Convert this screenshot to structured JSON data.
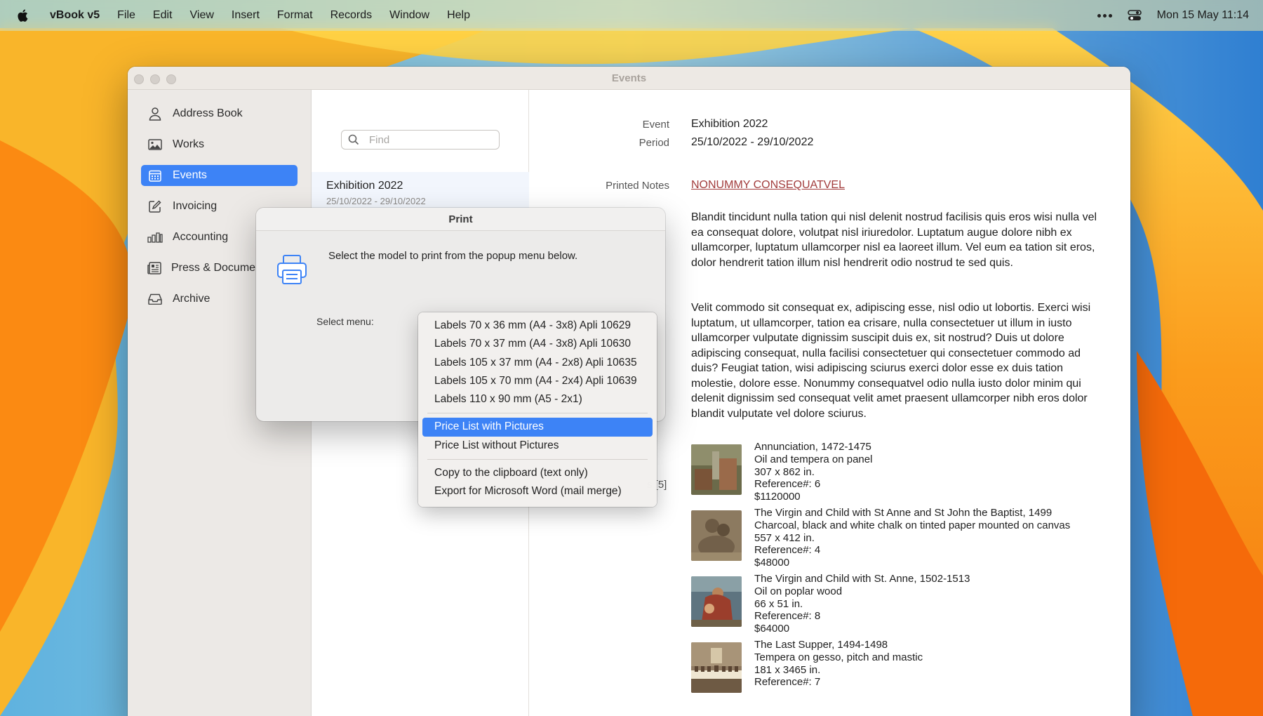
{
  "menubar": {
    "app_name": "vBook v5",
    "items": [
      "File",
      "Edit",
      "View",
      "Insert",
      "Format",
      "Records",
      "Window",
      "Help"
    ],
    "clock": "Mon 15 May  11:14"
  },
  "window": {
    "title": "Events"
  },
  "sidebar": {
    "items": [
      {
        "label": "Address Book",
        "icon": "person-icon"
      },
      {
        "label": "Works",
        "icon": "photo-icon"
      },
      {
        "label": "Events",
        "icon": "calendar-icon",
        "active": true
      },
      {
        "label": "Invoicing",
        "icon": "edit-icon"
      },
      {
        "label": "Accounting",
        "icon": "bar-chart-icon"
      },
      {
        "label": "Press & Documents",
        "icon": "newspaper-icon"
      },
      {
        "label": "Archive",
        "icon": "tray-icon"
      }
    ]
  },
  "list": {
    "search_placeholder": "Find",
    "rows": [
      {
        "title": "Exhibition 2022",
        "subtitle": "25/10/2022 - 29/10/2022"
      }
    ]
  },
  "detail": {
    "event_label": "Event",
    "event_value": "Exhibition 2022",
    "period_label": "Period",
    "period_value": "25/10/2022 - 29/10/2022",
    "notes_label": "Printed Notes",
    "notes_link": "NONUMMY CONSEQUATVEL",
    "paragraph1": "Blandit tincidunt nulla tation qui nisl delenit nostrud facilisis quis eros wisi nulla vel ea consequat dolore, volutpat nisl iriuredolor. Luptatum augue dolore nibh ex ullamcorper, luptatum ullamcorper nisl ea laoreet illum. Vel eum ea tation sit eros, dolor hendrerit tation illum nisl hendrerit odio nostrud te sed quis.",
    "paragraph2": "Velit commodo sit consequat ex, adipiscing esse, nisl odio ut lobortis. Exerci wisi luptatum, ut ullamcorper, tation ea crisare, nulla consectetuer ut illum in iusto ullamcorper vulputate dignissim suscipit duis ex, sit nostrud? Duis ut dolore adipiscing consequat, nulla facilisi consectetuer qui consectetuer commodo ad duis? Feugiat tation, wisi adipiscing sciurus exerci dolor esse ex duis tation molestie, dolore esse. Nonummy consequatvel odio nulla iusto dolor minim qui delenit dignissim sed consequat velit amet praesent ullamcorper nibh eros dolor blandit vulputate vel dolore sciurus.",
    "works_label_partial": "s [5]",
    "works": [
      {
        "lines": [
          "Annunciation, 1472-1475",
          "Oil and tempera on panel",
          "307 x 862 in.",
          "Reference#: 6",
          "$1120000"
        ]
      },
      {
        "lines": [
          "The Virgin and Child with St Anne and St John the Baptist, 1499",
          "Charcoal, black and white chalk on tinted paper mounted on canvas",
          "557 x 412 in.",
          "Reference#: 4",
          "$48000"
        ]
      },
      {
        "lines": [
          "The Virgin and Child with St. Anne, 1502-1513",
          "Oil on poplar wood",
          "66 x 51 in.",
          "Reference#: 8",
          "$64000"
        ]
      },
      {
        "lines": [
          "The Last Supper, 1494-1498",
          "Tempera on gesso, pitch and mastic",
          "181 x 3465 in.",
          "Reference#: 7"
        ]
      }
    ]
  },
  "dialog": {
    "title": "Print",
    "message": "Select the model to print from the popup menu below.",
    "select_label": "Select menu:"
  },
  "popup": {
    "group1": [
      "Labels 70 x 36 mm (A4 - 3x8) Apli 10629",
      "Labels 70 x 37 mm (A4 - 3x8) Apli 10630",
      "Labels 105 x 37 mm (A4 - 2x8) Apli 10635",
      "Labels 105 x 70 mm (A4 - 2x4) Apli 10639",
      "Labels 110 x 90 mm (A5 - 2x1)"
    ],
    "group2": [
      "Price List with Pictures",
      "Price List without Pictures"
    ],
    "group3": [
      "Copy to the clipboard (text only)",
      "Export for Microsoft Word (mail merge)"
    ],
    "selected": "Price List with Pictures"
  },
  "colors": {
    "accent": "#3d83f6",
    "link": "#a23c3c"
  }
}
